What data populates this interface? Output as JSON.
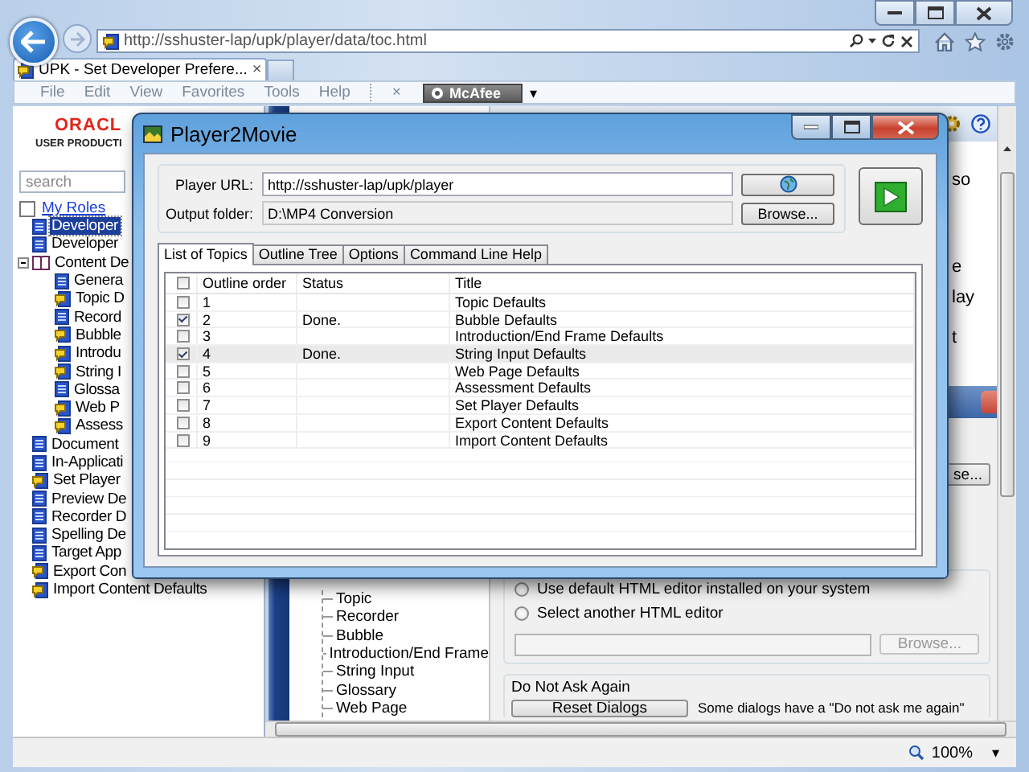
{
  "browser": {
    "address": "http://sshuster-lap/upk/player/data/toc.html",
    "tabs": [
      {
        "label": "UPK - Set Developer Prefere...",
        "selected": true
      }
    ],
    "tab_close": "×",
    "menu": [
      "File",
      "Edit",
      "View",
      "Favorites",
      "Tools",
      "Help"
    ],
    "toolbar_close": "×",
    "addon": "McAfee",
    "addon_menu": "▾"
  },
  "left_pane": {
    "logo_brand": "ORACL",
    "logo_product": "USER PRODUCTI",
    "search": {
      "placeholder": "search"
    },
    "roles": {
      "label": "My Roles",
      "checked": false
    },
    "tree": [
      {
        "label": "Developer",
        "kind": "page",
        "selected": true
      },
      {
        "label": "Developer",
        "kind": "page",
        "selected": false
      },
      {
        "label": "Content De",
        "kind": "book",
        "selected": false,
        "expanded": true,
        "children": [
          {
            "label": "Genera",
            "kind": "page",
            "selected": false
          },
          {
            "label": "Topic D",
            "kind": "topic",
            "selected": false
          },
          {
            "label": "Record",
            "kind": "page",
            "selected": false
          },
          {
            "label": "Bubble",
            "kind": "topic",
            "selected": false
          },
          {
            "label": "Introdu",
            "kind": "topic",
            "selected": false
          },
          {
            "label": "String I",
            "kind": "topic",
            "selected": false
          },
          {
            "label": "Glossa",
            "kind": "page",
            "selected": false
          },
          {
            "label": "Web P",
            "kind": "topic",
            "selected": false
          },
          {
            "label": "Assess",
            "kind": "topic",
            "selected": false
          }
        ]
      },
      {
        "label": "Document",
        "kind": "page",
        "selected": false
      },
      {
        "label": "In-Applicati",
        "kind": "page",
        "selected": false
      },
      {
        "label": "Set Player",
        "kind": "topic",
        "selected": false
      },
      {
        "label": "Preview De",
        "kind": "page",
        "selected": false
      },
      {
        "label": "Recorder D",
        "kind": "page",
        "selected": false
      },
      {
        "label": "Spelling De",
        "kind": "page",
        "selected": false
      },
      {
        "label": "Target App",
        "kind": "page",
        "selected": false
      },
      {
        "label": "Export Con",
        "kind": "topic",
        "selected": false
      },
      {
        "label": "Import Content Defaults",
        "kind": "topic",
        "selected": false
      }
    ]
  },
  "middle_pane": {
    "outline": [
      "Topic",
      "Recorder",
      "Bubble",
      "Introduction/End Frame",
      "String Input",
      "Glossary",
      "Web Page"
    ]
  },
  "right_pane": {
    "text_lines": [
      "so",
      "e",
      "lay",
      "t"
    ],
    "hidden_button": "se...",
    "editor_options": [
      {
        "label": "Use default HTML editor installed on your system",
        "selected": false
      },
      {
        "label": "Select another HTML editor",
        "selected": false
      }
    ],
    "editor_browse": {
      "label": "Browse...",
      "disabled": true
    },
    "do_not_ask": {
      "title": "Do Not Ask Again",
      "button": "Reset Dialogs",
      "note": "Some dialogs have a \"Do not ask me again\""
    }
  },
  "dialog": {
    "title": "Player2Movie",
    "player_url": {
      "label": "Player URL:",
      "value": "http://sshuster-lap/upk/player"
    },
    "output_folder": {
      "label": "Output folder:",
      "value": "D:\\MP4 Conversion"
    },
    "browse": "Browse...",
    "tabs": [
      {
        "label": "List of Topics",
        "selected": true
      },
      {
        "label": "Outline Tree",
        "selected": false
      },
      {
        "label": "Options",
        "selected": false
      },
      {
        "label": "Command Line Help",
        "selected": false
      }
    ],
    "select_all": false,
    "columns": [
      "Outline order",
      "Status",
      "Title"
    ],
    "rows": [
      {
        "checked": false,
        "selected": false,
        "order": "1",
        "title": "Topic Defaults"
      },
      {
        "checked": true,
        "selected": false,
        "order": "2",
        "status": "Done.",
        "title": "Bubble Defaults"
      },
      {
        "checked": false,
        "selected": false,
        "order": "3",
        "title": "Introduction/End Frame Defaults"
      },
      {
        "checked": true,
        "selected": true,
        "order": "4",
        "status": "Done.",
        "title": "String Input Defaults"
      },
      {
        "checked": false,
        "selected": false,
        "order": "5",
        "title": "Web Page Defaults"
      },
      {
        "checked": false,
        "selected": false,
        "order": "6",
        "title": "Assessment Defaults"
      },
      {
        "checked": false,
        "selected": false,
        "order": "7",
        "title": "Set Player Defaults"
      },
      {
        "checked": false,
        "selected": false,
        "order": "8",
        "title": "Export Content Defaults"
      },
      {
        "checked": false,
        "selected": false,
        "order": "9",
        "title": "Import Content Defaults"
      }
    ]
  },
  "status_bar": {
    "zoom": "100%",
    "zoom_menu": "▾"
  }
}
